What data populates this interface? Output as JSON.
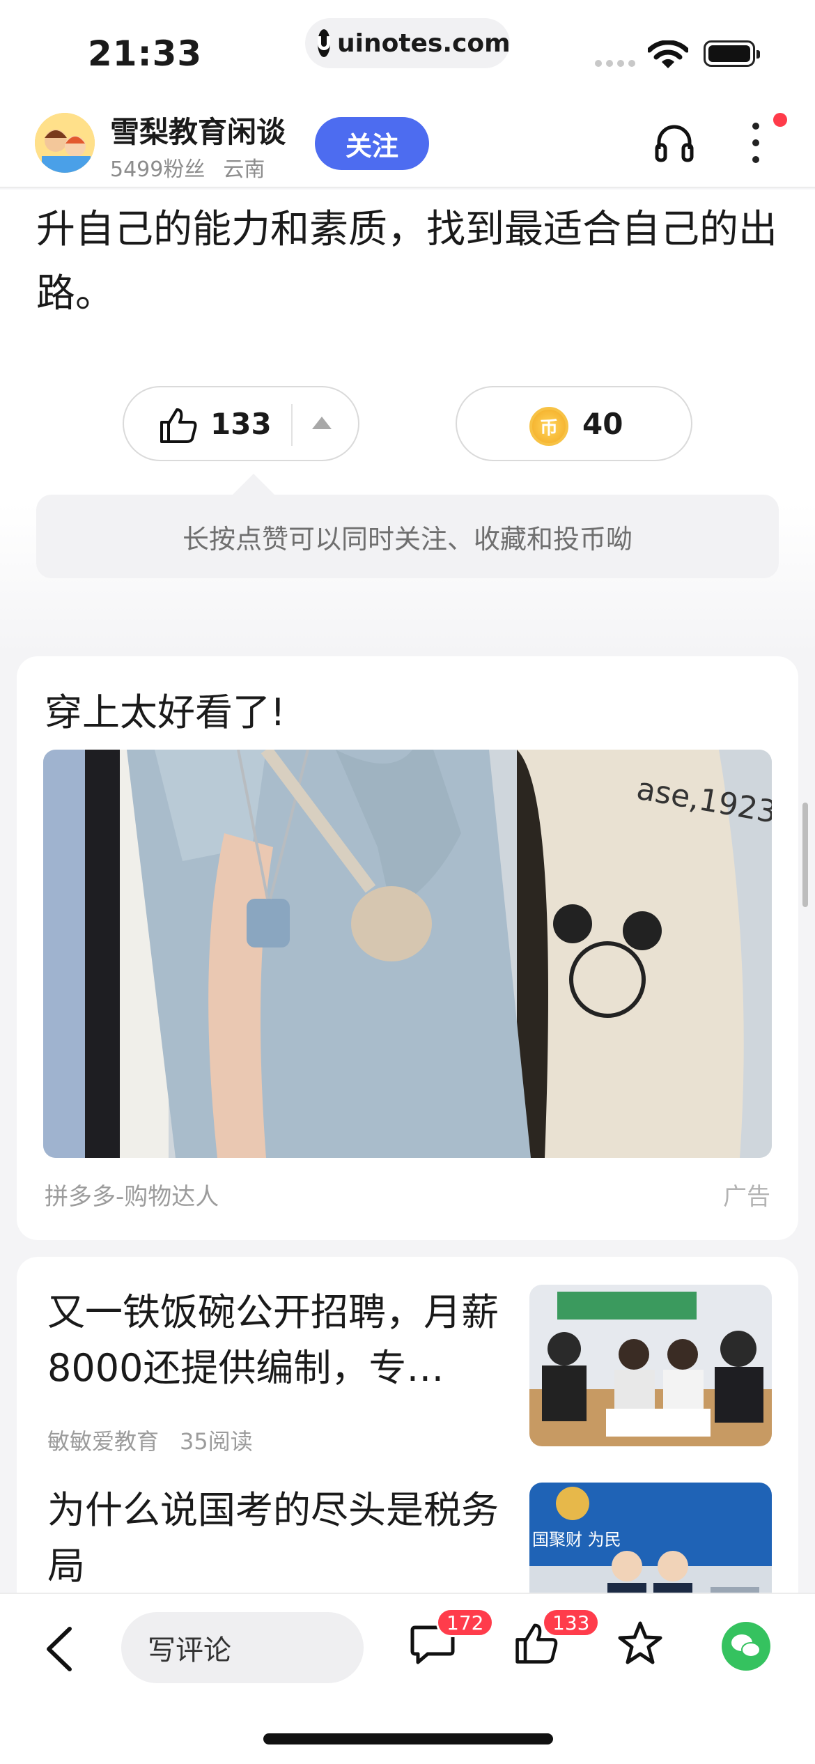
{
  "status_bar": {
    "time": "21:33",
    "url": "uinotes.com"
  },
  "header": {
    "author": "雪梨教育闲谈",
    "fans": "5499粉丝",
    "location": "云南",
    "follow_label": "关注"
  },
  "article": {
    "text": "升自己的能力和素质，找到最适合自己的出路。",
    "like_count": "133",
    "coin_count": "40",
    "coin_glyph": "币",
    "tip": "长按点赞可以同时关注、收藏和投币呦"
  },
  "ad": {
    "title": "穿上太好看了!",
    "source": "拼多多-购物达人",
    "tag": "广告",
    "bag_text": "ase,1923"
  },
  "news": [
    {
      "title": "又一铁饭碗公开招聘，月薪8000还提供编制，专…",
      "source": "敏敏爱教育",
      "reads": "35阅读"
    },
    {
      "title": "为什么说国考的尽头是税务局",
      "sign_text": "国聚财 为民"
    }
  ],
  "bottom_bar": {
    "comment_placeholder": "写评论",
    "comment_badge": "172",
    "like_badge": "133"
  },
  "colors": {
    "accent": "#4d6cf0",
    "badge": "#ff3c4b",
    "wechat": "#35c25f"
  }
}
